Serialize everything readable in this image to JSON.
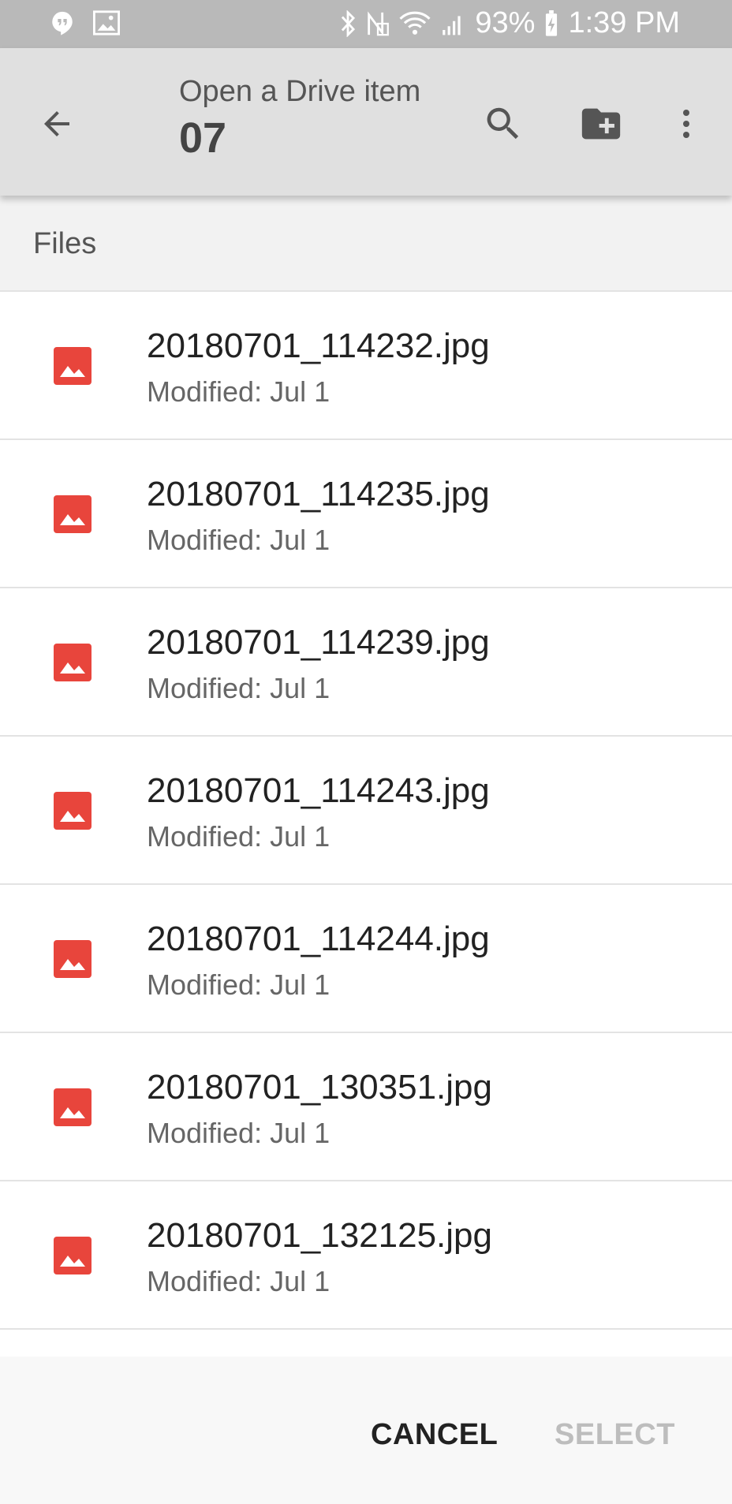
{
  "status_bar": {
    "battery": "93%",
    "time": "1:39 PM",
    "icons": [
      "hangouts-icon",
      "image-icon",
      "bluetooth-icon",
      "nfc-icon",
      "wifi-icon",
      "signal-icon",
      "battery-charging-icon"
    ]
  },
  "app_bar": {
    "subtitle": "Open a Drive item",
    "title": "07",
    "icons": [
      "back-arrow-icon",
      "search-icon",
      "new-folder-icon",
      "more-vert-icon"
    ]
  },
  "section": {
    "label": "Files"
  },
  "files": [
    {
      "name": "20180701_114232.jpg",
      "modified": "Modified: Jul 1"
    },
    {
      "name": "20180701_114235.jpg",
      "modified": "Modified: Jul 1"
    },
    {
      "name": "20180701_114239.jpg",
      "modified": "Modified: Jul 1"
    },
    {
      "name": "20180701_114243.jpg",
      "modified": "Modified: Jul 1"
    },
    {
      "name": "20180701_114244.jpg",
      "modified": "Modified: Jul 1"
    },
    {
      "name": "20180701_130351.jpg",
      "modified": "Modified: Jul 1"
    },
    {
      "name": "20180701_132125.jpg",
      "modified": "Modified: Jul 1"
    }
  ],
  "actions": {
    "cancel": "CANCEL",
    "select": "SELECT"
  },
  "colors": {
    "accent_image_icon": "#e8453c",
    "app_bar": "#e0e0e0",
    "status_bar": "#b9b9b9"
  }
}
